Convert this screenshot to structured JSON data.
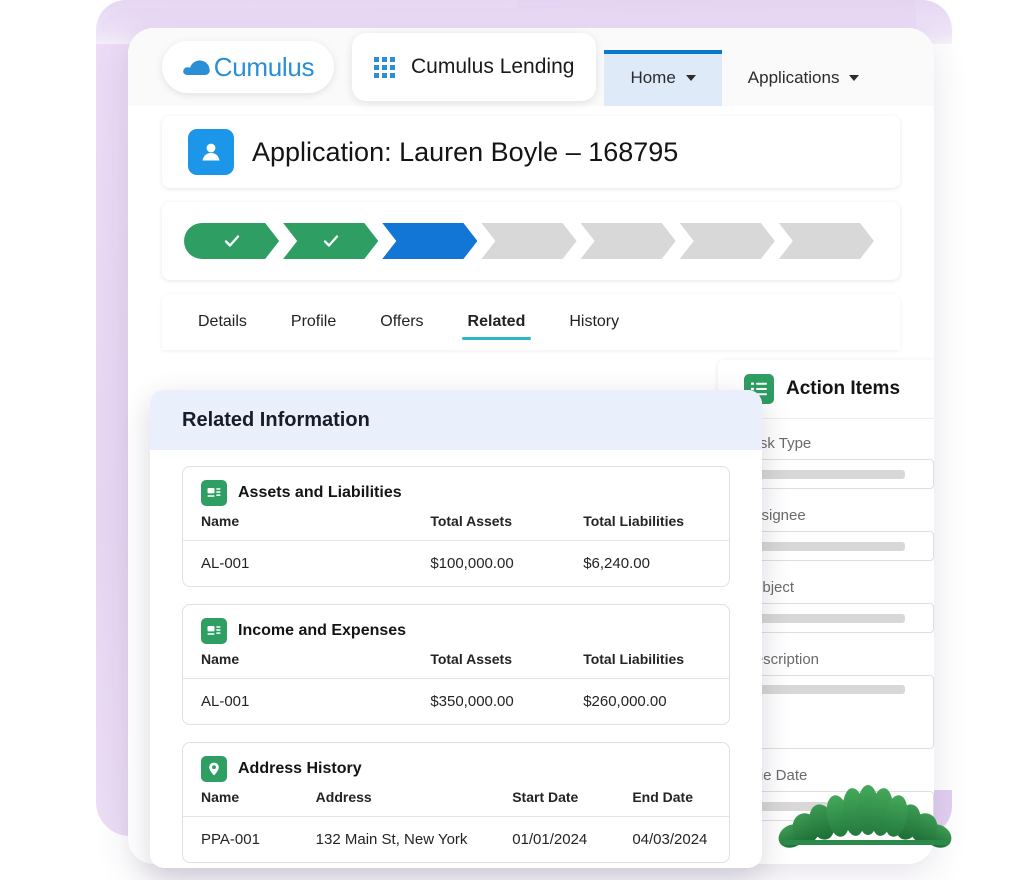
{
  "brand": {
    "logo_text": "Cumulus",
    "logo_color": "#2b8fd6",
    "app_name": "Cumulus Lending"
  },
  "globalnav": {
    "tabs": [
      {
        "label": "Home",
        "active": true
      },
      {
        "label": "Applications",
        "active": false
      }
    ],
    "active_tab_accent": "#0b78d0"
  },
  "record": {
    "title": "Application: Lauren Boyle – 168795",
    "icon": "person-icon",
    "icon_color": "#1b96e8"
  },
  "path": {
    "steps": [
      {
        "state": "done"
      },
      {
        "state": "done"
      },
      {
        "state": "current"
      },
      {
        "state": "todo"
      },
      {
        "state": "todo"
      },
      {
        "state": "todo"
      },
      {
        "state": "todo"
      }
    ],
    "done_color": "#2e9e63",
    "current_color": "#1176d6",
    "todo_color": "#d8d8d8"
  },
  "subtabs": {
    "items": [
      {
        "label": "Details",
        "active": false
      },
      {
        "label": "Profile",
        "active": false
      },
      {
        "label": "Offers",
        "active": false
      },
      {
        "label": "Related",
        "active": true
      },
      {
        "label": "History",
        "active": false
      }
    ],
    "active_underline": "#2fb6c4"
  },
  "related": {
    "header": "Related Information",
    "header_bg": "#e9f0fb",
    "blocks": [
      {
        "title": "Assets and Liabilities",
        "icon": "record-list-icon",
        "columns": [
          "Name",
          "Total Assets",
          "Total Liabilities"
        ],
        "rows": [
          [
            "AL-001",
            "$100,000.00",
            "$6,240.00"
          ]
        ]
      },
      {
        "title": "Income and Expenses",
        "icon": "record-list-icon",
        "columns": [
          "Name",
          "Total Assets",
          "Total Liabilities"
        ],
        "rows": [
          [
            "AL-001",
            "$350,000.00",
            "$260,000.00"
          ]
        ]
      },
      {
        "title": "Address History",
        "icon": "location-pin-icon",
        "columns": [
          "Name",
          "Address",
          "Start Date",
          "End Date"
        ],
        "rows": [
          [
            "PPA-001",
            "132 Main St, New York",
            "01/01/2024",
            "04/03/2024"
          ]
        ]
      }
    ]
  },
  "action_panel": {
    "title": "Action Items",
    "icon": "checklist-icon",
    "icon_color": "#2e9e63",
    "fields": [
      {
        "label": "Task Type",
        "value": "",
        "type": "input"
      },
      {
        "label": "Assignee",
        "value": "",
        "type": "input"
      },
      {
        "label": "Subject",
        "value": "",
        "type": "input"
      },
      {
        "label": "Description",
        "value": "",
        "type": "textarea"
      },
      {
        "label": "Due Date",
        "value": "",
        "type": "input"
      }
    ]
  }
}
